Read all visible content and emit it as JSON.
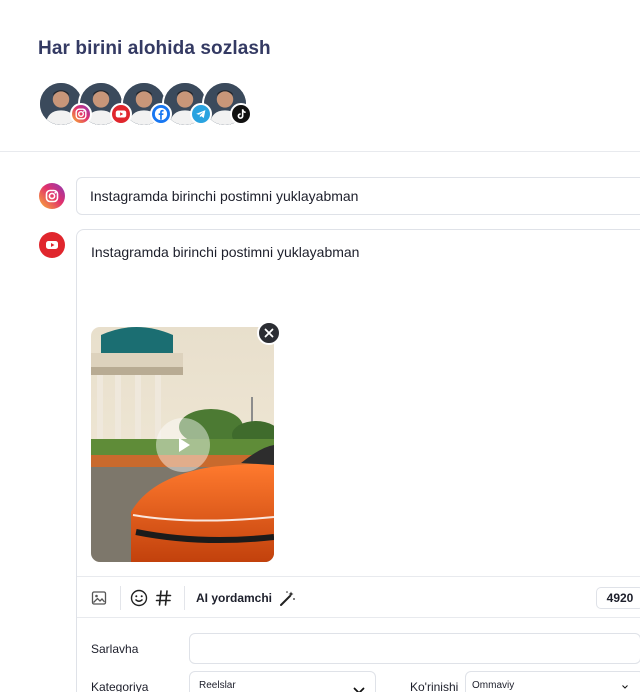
{
  "page": {
    "title": "Har birini alohida sozlash"
  },
  "avatars": [
    {
      "platform": "instagram",
      "icon": "instagram-icon",
      "color": "#e1306c"
    },
    {
      "platform": "youtube",
      "icon": "youtube-icon",
      "color": "#e0262d"
    },
    {
      "platform": "facebook",
      "icon": "facebook-icon",
      "color": "#1877f2"
    },
    {
      "platform": "telegram",
      "icon": "telegram-icon",
      "color": "#2aa3e0"
    },
    {
      "platform": "tiktok",
      "icon": "tiktok-icon",
      "color": "#111111"
    }
  ],
  "instagram_post": {
    "text": "Instagramda birinchi postimni yuklayabman"
  },
  "youtube_post": {
    "text": "Instagramda birinchi postimni yuklayabman",
    "toolbar": {
      "ai_label": "AI yordamchi",
      "char_count": "4920"
    },
    "fields": {
      "title_label": "Sarlavha",
      "title_value": "",
      "category_label": "Kategoriya",
      "category_value": "Reelslar",
      "visibility_label": "Ko'rinishi",
      "visibility_value": "Ommaviy"
    }
  },
  "colors": {
    "title": "#343a63",
    "border": "#dfe2e8",
    "instagram": "#e1306c",
    "youtube": "#e0262d"
  }
}
